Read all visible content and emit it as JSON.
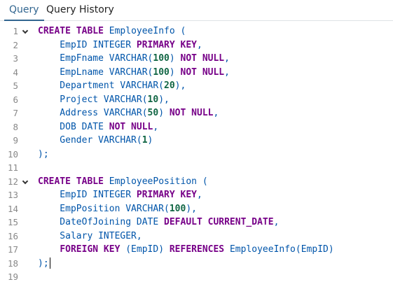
{
  "tabs": [
    {
      "label": "Query",
      "active": true
    },
    {
      "label": "Query History",
      "active": false
    }
  ],
  "editor": {
    "lines": [
      {
        "n": "1",
        "fold": true,
        "tokens": [
          [
            "kw",
            "CREATE"
          ],
          [
            "t",
            " "
          ],
          [
            "kw",
            "TABLE"
          ],
          [
            "t",
            " EmployeeInfo ("
          ]
        ]
      },
      {
        "n": "2",
        "tokens": [
          [
            "t",
            "    EmpID INTEGER "
          ],
          [
            "kw",
            "PRIMARY KEY"
          ],
          [
            "t",
            ","
          ]
        ]
      },
      {
        "n": "3",
        "tokens": [
          [
            "t",
            "    EmpFname VARCHAR("
          ],
          [
            "num",
            "100"
          ],
          [
            "t",
            ") "
          ],
          [
            "kw",
            "NOT NULL"
          ],
          [
            "t",
            ","
          ]
        ]
      },
      {
        "n": "4",
        "tokens": [
          [
            "t",
            "    EmpLname VARCHAR("
          ],
          [
            "num",
            "100"
          ],
          [
            "t",
            ") "
          ],
          [
            "kw",
            "NOT NULL"
          ],
          [
            "t",
            ","
          ]
        ]
      },
      {
        "n": "5",
        "tokens": [
          [
            "t",
            "    Department VARCHAR("
          ],
          [
            "num",
            "20"
          ],
          [
            "t",
            "),"
          ]
        ]
      },
      {
        "n": "6",
        "tokens": [
          [
            "t",
            "    Project VARCHAR("
          ],
          [
            "num",
            "10"
          ],
          [
            "t",
            "),"
          ]
        ]
      },
      {
        "n": "7",
        "tokens": [
          [
            "t",
            "    Address VARCHAR("
          ],
          [
            "num",
            "50"
          ],
          [
            "t",
            ") "
          ],
          [
            "kw",
            "NOT NULL"
          ],
          [
            "t",
            ","
          ]
        ]
      },
      {
        "n": "8",
        "tokens": [
          [
            "t",
            "    DOB DATE "
          ],
          [
            "kw",
            "NOT NULL"
          ],
          [
            "t",
            ","
          ]
        ]
      },
      {
        "n": "9",
        "tokens": [
          [
            "t",
            "    Gender VARCHAR("
          ],
          [
            "num",
            "1"
          ],
          [
            "t",
            ")"
          ]
        ]
      },
      {
        "n": "10",
        "tokens": [
          [
            "t",
            ");"
          ]
        ]
      },
      {
        "n": "11",
        "tokens": []
      },
      {
        "n": "12",
        "fold": true,
        "tokens": [
          [
            "kw",
            "CREATE"
          ],
          [
            "t",
            " "
          ],
          [
            "kw",
            "TABLE"
          ],
          [
            "t",
            " EmployeePosition ("
          ]
        ]
      },
      {
        "n": "13",
        "tokens": [
          [
            "t",
            "    EmpID INTEGER "
          ],
          [
            "kw",
            "PRIMARY KEY"
          ],
          [
            "t",
            ","
          ]
        ]
      },
      {
        "n": "14",
        "tokens": [
          [
            "t",
            "    EmpPosition VARCHAR("
          ],
          [
            "num",
            "100"
          ],
          [
            "t",
            "),"
          ]
        ]
      },
      {
        "n": "15",
        "tokens": [
          [
            "t",
            "    DateOfJoining DATE "
          ],
          [
            "kw",
            "DEFAULT CURRENT_DATE"
          ],
          [
            "t",
            ","
          ]
        ]
      },
      {
        "n": "16",
        "tokens": [
          [
            "t",
            "    Salary INTEGER,"
          ]
        ]
      },
      {
        "n": "17",
        "tokens": [
          [
            "t",
            "    "
          ],
          [
            "kw",
            "FOREIGN KEY"
          ],
          [
            "t",
            " (EmpID) "
          ],
          [
            "kw",
            "REFERENCES"
          ],
          [
            "t",
            " EmployeeInfo(EmpID)"
          ]
        ]
      },
      {
        "n": "18",
        "cursor": true,
        "tokens": [
          [
            "t",
            ");"
          ]
        ]
      },
      {
        "n": "19",
        "tokens": []
      }
    ]
  }
}
